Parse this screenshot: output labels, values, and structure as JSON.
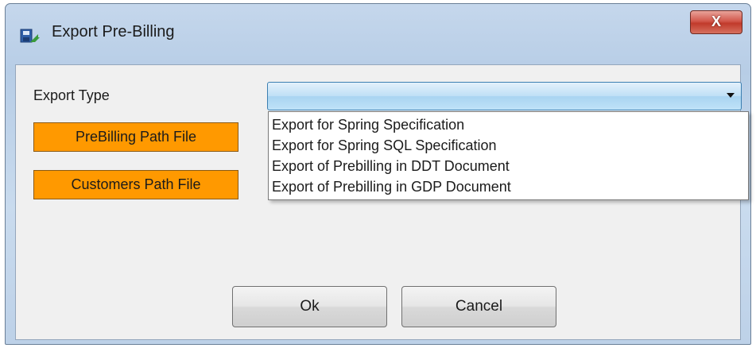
{
  "window": {
    "title": "Export Pre-Billing",
    "close_label": "X",
    "title_icon": "save-disk-icon"
  },
  "form": {
    "export_type_label": "Export Type",
    "export_type_selected": "",
    "export_type_options": [
      "Export for Spring Specification",
      "Export for Spring SQL Specification",
      "Export of Prebilling in DDT Document",
      "Export of Prebilling in GDP Document"
    ],
    "prebilling_path_button": "PreBilling Path File",
    "customers_path_button": "Customers Path File"
  },
  "buttons": {
    "ok": "Ok",
    "cancel": "Cancel"
  },
  "colors": {
    "path_button_bg": "#ff9900",
    "combo_highlight": "#bfe0f6",
    "close_button": "#c94a3c"
  }
}
